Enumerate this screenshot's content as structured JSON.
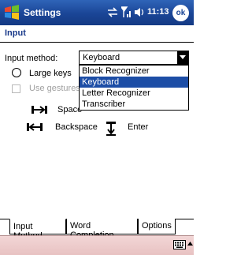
{
  "titlebar": {
    "app_title": "Settings",
    "clock": "11:13",
    "ok_label": "ok"
  },
  "page": {
    "title": "Input"
  },
  "form": {
    "input_method_label": "Input method:",
    "input_method_value": "Keyboard",
    "large_keys_label": "Large keys",
    "use_gestures_label": "Use gestures",
    "gestures": {
      "space_label": "Space",
      "backspace_label": "Backspace",
      "enter_label": "Enter"
    }
  },
  "dropdown": {
    "options": [
      "Block Recognizer",
      "Keyboard",
      "Letter Recognizer",
      "Transcriber"
    ],
    "selected": "Keyboard"
  },
  "tabs": [
    "Input Method",
    "Word Completion",
    "Options"
  ],
  "active_tab": "Input Method",
  "colors": {
    "titlebar": "#1a4596",
    "selection": "#1d4ea6",
    "menubar": "#edcaca"
  },
  "icons": {
    "start": "windows-flag-icon",
    "sync": "sync-arrows-icon",
    "signal": "signal-bars-icon",
    "volume": "speaker-icon",
    "sip": "keyboard-icon"
  }
}
